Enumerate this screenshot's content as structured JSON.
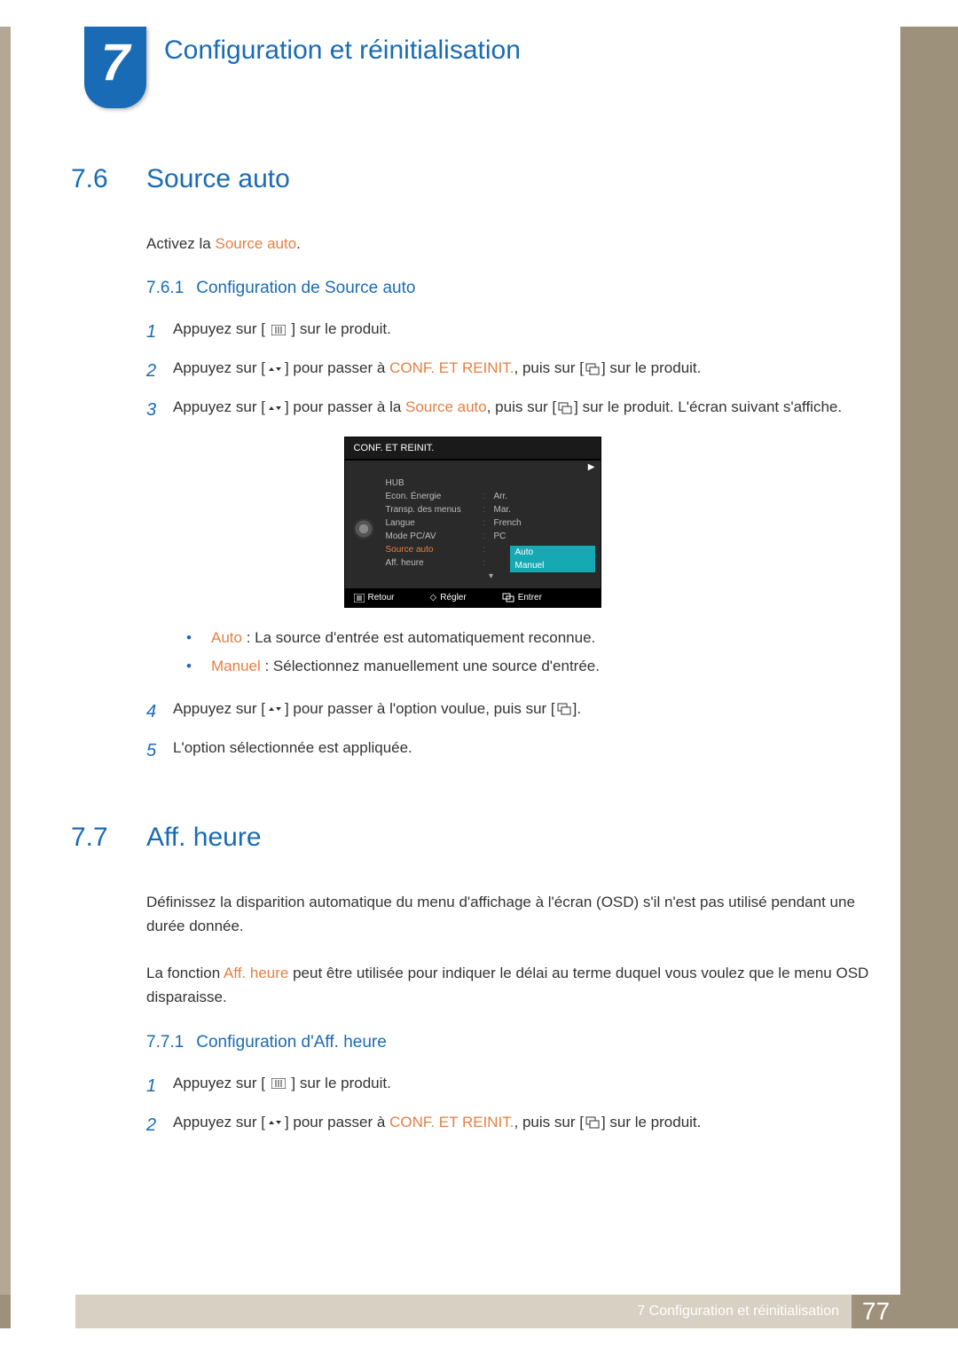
{
  "chapter": {
    "number": "7",
    "title": "Configuration et réinitialisation"
  },
  "section76": {
    "num": "7.6",
    "title": "Source auto",
    "intro_prefix": "Activez la ",
    "intro_term": "Source auto",
    "intro_suffix": ".",
    "sub": {
      "num": "7.6.1",
      "title": "Configuration de Source auto"
    },
    "step1_a": "Appuyez sur [ ",
    "step1_b": " ] sur le produit.",
    "step2_a": "Appuyez sur [",
    "step2_b": "] pour passer à ",
    "step2_term": "CONF. ET REINIT.",
    "step2_c": ", puis sur [",
    "step2_d": "] sur le produit.",
    "step3_a": "Appuyez sur [",
    "step3_b": "] pour passer à la ",
    "step3_term": "Source auto",
    "step3_c": ", puis sur [",
    "step3_d": "] sur le produit. L'écran suivant s'affiche.",
    "bullet1_term": "Auto",
    "bullet1_rest": " : La source d'entrée est automatiquement reconnue.",
    "bullet2_term": "Manuel",
    "bullet2_rest": " : Sélectionnez manuellement une source d'entrée.",
    "step4_a": "Appuyez sur [",
    "step4_b": "] pour passer à l'option voulue, puis sur [",
    "step4_c": "].",
    "step5": "L'option sélectionnée est appliquée."
  },
  "osd": {
    "title": "CONF. ET REINIT.",
    "rows": [
      {
        "label": "HUB",
        "value": ""
      },
      {
        "label": "Econ. Énergie",
        "value": "Arr."
      },
      {
        "label": "Transp. des menus",
        "value": "Mar."
      },
      {
        "label": "Langue",
        "value": "French"
      },
      {
        "label": "Mode PC/AV",
        "value": "PC"
      },
      {
        "label": "Source auto",
        "value": ""
      },
      {
        "label": "Aff. heure",
        "value": ""
      }
    ],
    "dropdown": [
      "Auto",
      "Manuel"
    ],
    "footer": {
      "back": "Retour",
      "adjust": "Régler",
      "enter": "Entrer"
    }
  },
  "section77": {
    "num": "7.7",
    "title": "Aff. heure",
    "p1": "Définissez la disparition automatique du menu d'affichage à l'écran (OSD) s'il n'est pas utilisé pendant une durée donnée.",
    "p2_a": "La fonction ",
    "p2_term": "Aff. heure",
    "p2_b": " peut être utilisée pour indiquer le délai au terme duquel vous voulez que le menu OSD disparaisse.",
    "sub": {
      "num": "7.7.1",
      "title": "Configuration d'Aff. heure"
    },
    "step1_a": "Appuyez sur [ ",
    "step1_b": " ] sur le produit.",
    "step2_a": "Appuyez sur [",
    "step2_b": "] pour passer à ",
    "step2_term": "CONF. ET REINIT.",
    "step2_c": ", puis sur [",
    "step2_d": "] sur le produit."
  },
  "footer": {
    "text": "7 Configuration et réinitialisation",
    "page": "77"
  }
}
